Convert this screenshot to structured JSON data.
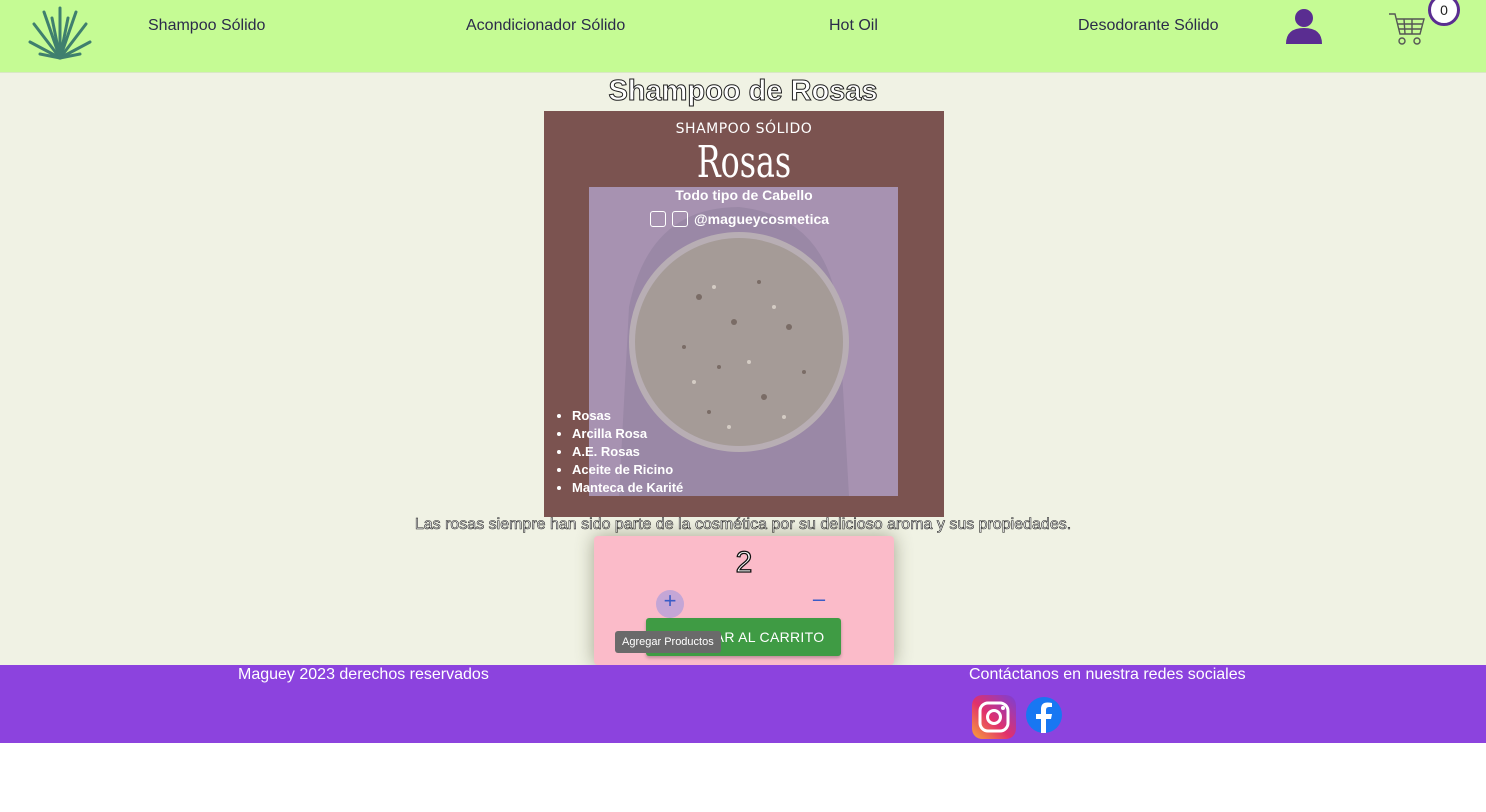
{
  "nav": {
    "links": [
      "Shampoo Sólido",
      "Acondicionador Sólido",
      "Hot Oil",
      "Desodorante Sólido"
    ],
    "cart_count": "0",
    "icons": {
      "logo": "agave-logo",
      "user": "user-icon",
      "cart": "cart-icon"
    }
  },
  "product": {
    "title": "Shampoo de Rosas",
    "image": {
      "kicker": "SHAMPOO SÓLIDO",
      "name": "Rosas",
      "hair_type": "Todo tipo de Cabello",
      "handle": "@magueycosmetica",
      "ingredients": [
        "Rosas",
        "Arcilla Rosa",
        "A.E. Rosas",
        "Aceite de Ricino",
        "Manteca de Karité"
      ]
    },
    "description": "Las rosas siempre han sido parte de la cosmética por su delicioso aroma y sus propiedades."
  },
  "cart_widget": {
    "quantity": "2",
    "plus": "+",
    "minus": "–",
    "add_label": "AGREGAR AL CARRITO",
    "tooltip": "Agregar Productos"
  },
  "footer": {
    "copyright": "Maguey 2023 derechos reservados",
    "contact": "Contáctanos en nuestra redes sociales",
    "social": [
      "instagram-icon",
      "facebook-icon"
    ]
  },
  "colors": {
    "nav_bg": "#c5fb94",
    "page_bg": "#f0f2e4",
    "footer_bg": "#8c43de",
    "card_bg": "#fbbbc9",
    "add_button": "#3f9b44",
    "accent_purple": "#5a2d91"
  }
}
